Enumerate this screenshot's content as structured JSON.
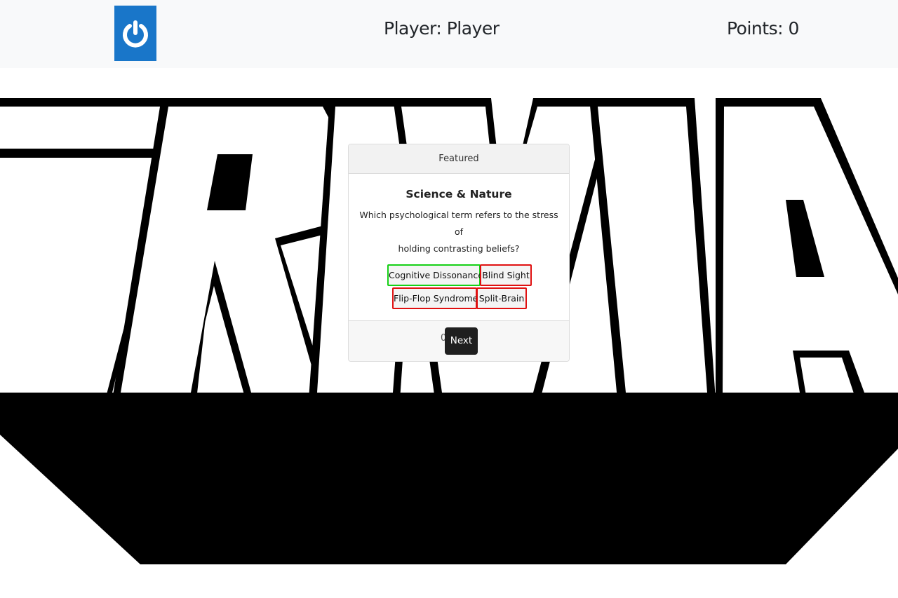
{
  "navbar": {
    "logo_icon": "power-icon",
    "logo_color": "#1976c9",
    "player_label": "Player: Player",
    "points_label": "Points: 0"
  },
  "banner": {
    "word": "TRIVIA"
  },
  "card": {
    "header": "Featured",
    "category": "Science & Nature",
    "question_line1": "Which psychological term refers to the stress of",
    "question_line2": "holding contrasting beliefs?",
    "answers": [
      {
        "label": "Cognitive Dissonance",
        "state": "correct"
      },
      {
        "label": "Blind Sight",
        "state": "incorrect"
      },
      {
        "label": "Flip-Flop Syndrome",
        "state": "incorrect"
      },
      {
        "label": "Split-Brain",
        "state": "incorrect"
      }
    ],
    "footer_text": "0",
    "next_label": "Next"
  },
  "colors": {
    "correct_border": "#16d016",
    "incorrect_border": "#e01010",
    "next_button": "#1f1f1f"
  }
}
